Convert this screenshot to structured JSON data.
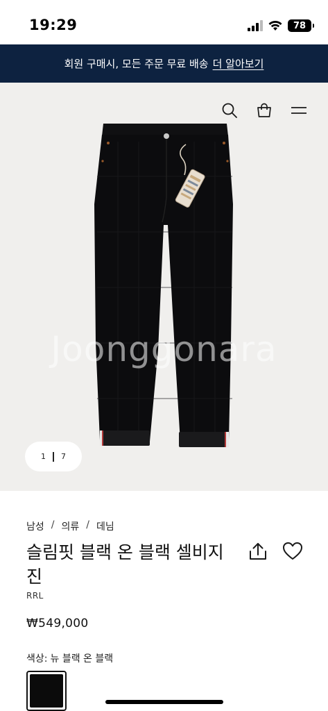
{
  "status_bar": {
    "time": "19:29",
    "battery": "78"
  },
  "promo": {
    "text": "회원 구매시, 모든 주문 무료 배송",
    "link": "더 알아보기"
  },
  "hero": {
    "watermark": "Joonggonara",
    "pager": {
      "current": "1",
      "total": "7"
    }
  },
  "breadcrumb": {
    "items": [
      "남성",
      "의류",
      "데님"
    ],
    "separator": "/"
  },
  "product": {
    "title": "슬림핏 블랙 온 블랙 셀비지 진",
    "brand": "RRL",
    "price": "₩549,000",
    "color_label": "색상:",
    "color_value": "뉴 블랙 온 블랙"
  },
  "icons": [
    "search-icon",
    "shopping-bag-icon",
    "menu-icon",
    "share-icon",
    "heart-icon",
    "signal-icon",
    "wifi-icon",
    "battery-icon"
  ],
  "colors": {
    "banner": "#0d2240",
    "hero_bg": "#f0efed",
    "denim": "#0c0c0e"
  }
}
